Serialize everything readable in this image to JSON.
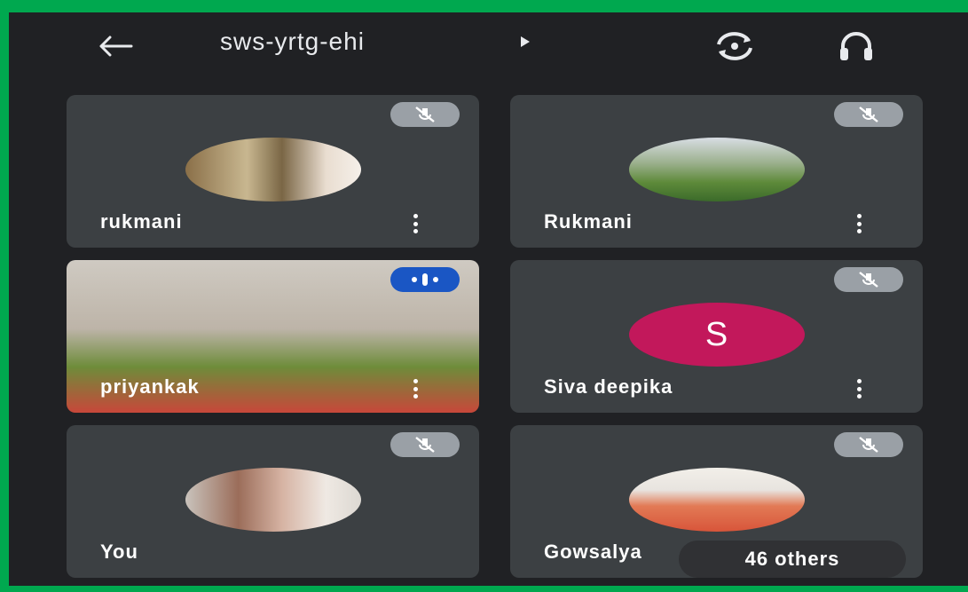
{
  "header": {
    "meeting_code": "sws-yrtg-ehi",
    "back_icon": "arrow-left-icon",
    "camera_switch_icon": "switch-camera-icon",
    "audio_icon": "headphones-icon"
  },
  "participants": [
    {
      "name": "rukmani",
      "status": "muted"
    },
    {
      "name": "Rukmani",
      "status": "muted"
    },
    {
      "name": "priyankak",
      "status": "speaking"
    },
    {
      "name": "Siva deepika",
      "status": "muted",
      "initial": "S"
    },
    {
      "name": "You",
      "status": "muted"
    },
    {
      "name": "Gowsalya",
      "status": "muted"
    }
  ],
  "others_badge": "46 others",
  "colors": {
    "background": "#202124",
    "tile": "#3c4043",
    "speaking_indicator": "#1a56c4",
    "initial_avatar": "#c2185b",
    "frame": "#00a84f"
  }
}
